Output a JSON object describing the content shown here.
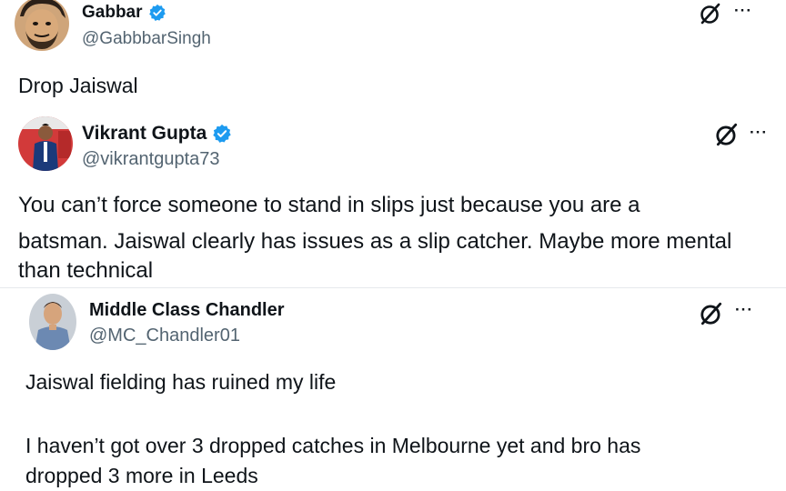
{
  "tweets": [
    {
      "name": "Gabbar",
      "handle": "@GabbbarSingh",
      "verified": true,
      "body": [
        "Drop Jaiswal"
      ]
    },
    {
      "name": "Vikrant Gupta",
      "handle": "@vikrantgupta73",
      "verified": true,
      "body": [
        "You can’t force someone to stand in slips just because you are a",
        "batsman. Jaiswal clearly has issues as a slip catcher. Maybe more mental",
        "than technical"
      ]
    },
    {
      "name": "Middle Class Chandler",
      "handle": "@MC_Chandler01",
      "verified": false,
      "body": [
        "Jaiswal fielding has ruined my life",
        "",
        "I haven’t got over 3 dropped catches in Melbourne yet and bro has",
        "dropped 3 more in Leeds"
      ]
    }
  ],
  "icons": {
    "grok": "grok-icon",
    "more": "more-options-icon",
    "verified": "verified-badge-icon"
  },
  "more_glyph": "···",
  "colors": {
    "verified": "#1d9bf0",
    "handle": "#536471",
    "text": "#0f1419"
  }
}
